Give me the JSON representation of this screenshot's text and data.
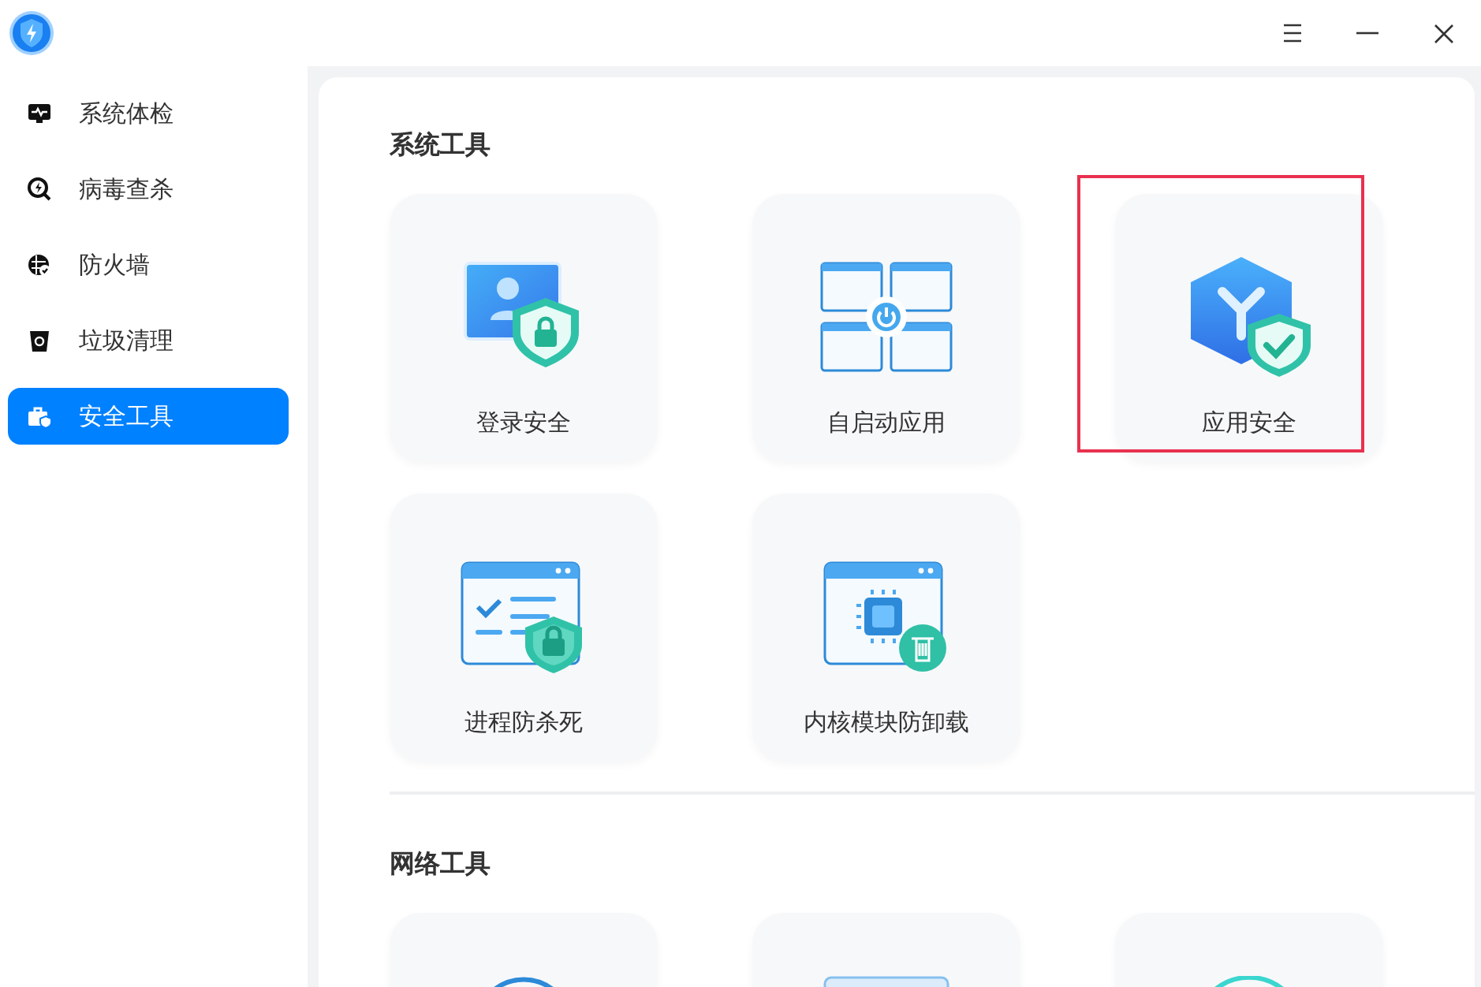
{
  "titlebar": {
    "buttons": [
      {
        "kind": "menu"
      },
      {
        "kind": "minimize"
      },
      {
        "kind": "close"
      }
    ]
  },
  "sidebar": {
    "items": [
      {
        "label": "系统体检",
        "kind": "monitor",
        "selected": false
      },
      {
        "label": "病毒查杀",
        "kind": "scan",
        "selected": false
      },
      {
        "label": "防火墙",
        "kind": "firewall",
        "selected": false
      },
      {
        "label": "垃圾清理",
        "kind": "trash",
        "selected": false
      },
      {
        "label": "安全工具",
        "kind": "toolbox",
        "selected": true
      }
    ]
  },
  "sections": [
    {
      "title": "系统工具",
      "cards": [
        {
          "label": "登录安全",
          "kind": "login",
          "highlighted": false
        },
        {
          "label": "自启动应用",
          "kind": "autostart",
          "highlighted": false
        },
        {
          "label": "应用安全",
          "kind": "app",
          "highlighted": true
        },
        {
          "label": "进程防杀死",
          "kind": "process",
          "highlighted": false
        },
        {
          "label": "内核模块防卸载",
          "kind": "kernel",
          "highlighted": false
        }
      ]
    },
    {
      "title": "网络工具",
      "cards": [
        {
          "kind": "globe",
          "highlighted": false
        },
        {
          "kind": "panel",
          "highlighted": false
        },
        {
          "kind": "ring",
          "highlighted": false
        }
      ]
    }
  ]
}
